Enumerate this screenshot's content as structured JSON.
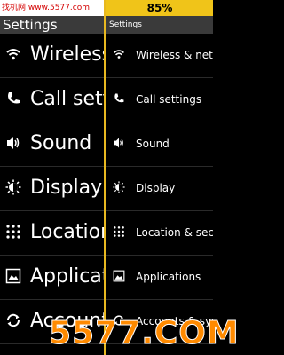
{
  "left_pane": {
    "site_label": "找机网 www.5577.com",
    "title": "Settings",
    "items": [
      {
        "label": "Wireless",
        "icon": "wifi-icon"
      },
      {
        "label": "Call settings",
        "icon": "phone-icon"
      },
      {
        "label": "Sound",
        "icon": "speaker-icon"
      },
      {
        "label": "Display",
        "icon": "brightness-icon"
      },
      {
        "label": "Location",
        "icon": "location-grid-icon"
      },
      {
        "label": "Applications",
        "icon": "applications-icon"
      },
      {
        "label": "Accounts",
        "icon": "sync-icon"
      }
    ]
  },
  "right_pane": {
    "battery_percent": "85%",
    "title": "Settings",
    "items": [
      {
        "label": "Wireless & networks",
        "icon": "wifi-icon"
      },
      {
        "label": "Call settings",
        "icon": "phone-icon"
      },
      {
        "label": "Sound",
        "icon": "speaker-icon"
      },
      {
        "label": "Display",
        "icon": "brightness-icon"
      },
      {
        "label": "Location & security",
        "icon": "location-grid-icon"
      },
      {
        "label": "Applications",
        "icon": "applications-icon"
      },
      {
        "label": "Accounts & sync",
        "icon": "sync-icon"
      }
    ]
  },
  "watermark": {
    "text": "5577.COM"
  },
  "colors": {
    "accent": "#f0c419",
    "separator": "#e8b820",
    "watermark": "#ff8a00"
  }
}
